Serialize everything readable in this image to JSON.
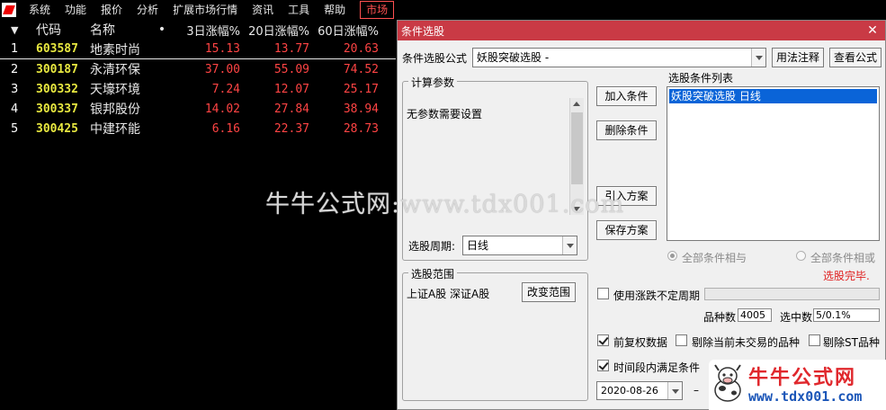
{
  "menu": {
    "items": [
      "系统",
      "功能",
      "报价",
      "分析",
      "扩展市场行情",
      "资讯",
      "工具",
      "帮助"
    ],
    "market": "市场"
  },
  "table": {
    "headers": {
      "code": "代码",
      "name": "名称",
      "dot": "•",
      "c3": "3日涨幅%",
      "c20": "20日涨幅%",
      "c60": "60日涨幅%"
    },
    "rows": [
      {
        "idx": "1",
        "code": "603587",
        "name": "地素时尚",
        "c3": "15.13",
        "c20": "13.77",
        "c60": "20.63"
      },
      {
        "idx": "2",
        "code": "300187",
        "name": "永清环保",
        "c3": "37.00",
        "c20": "55.09",
        "c60": "74.52"
      },
      {
        "idx": "3",
        "code": "300332",
        "name": "天壕环境",
        "c3": "7.24",
        "c20": "12.07",
        "c60": "25.17"
      },
      {
        "idx": "4",
        "code": "300337",
        "name": "银邦股份",
        "c3": "14.02",
        "c20": "27.84",
        "c60": "38.94"
      },
      {
        "idx": "5",
        "code": "300425",
        "name": "中建环能",
        "c3": "6.16",
        "c20": "22.37",
        "c60": "28.73"
      }
    ]
  },
  "dialog": {
    "title": "条件选股",
    "close": "✕",
    "formula_label": "条件选股公式",
    "formula_value": "妖股突破选股 -",
    "btn_usage": "用法注释",
    "btn_view": "查看公式",
    "params_group": "计算参数",
    "params_text": "无参数需要设置",
    "period_label": "选股周期:",
    "period_value": "日线",
    "btn_add": "加入条件",
    "btn_delete": "删除条件",
    "btn_import": "引入方案",
    "btn_save": "保存方案",
    "cond_list_label": "选股条件列表",
    "cond_list_items": [
      "妖股突破选股  日线"
    ],
    "radio_and": "全部条件相与",
    "radio_or": "全部条件相或",
    "status": "选股完毕.",
    "range_group": "选股范围",
    "range_text": "上证A股  深证A股",
    "btn_change_range": "改变范围",
    "chk_uncertain": "使用涨跌不定周期",
    "count_label": "品种数",
    "count_value": "4005",
    "selected_label": "选中数",
    "selected_value": "5/0.1%",
    "chk_prerights": "前复权数据",
    "chk_exclude_untraded": "剔除当前未交易的品种",
    "chk_exclude_st": "剔除ST品种",
    "chk_period_satisfy": "时间段内满足条件",
    "date_value": "2020-08-26",
    "dash": "–"
  },
  "watermark": {
    "center": "牛牛公式网:www.tdx001.com",
    "logo_title": "牛牛公式网",
    "logo_url": "www.tdx001.com"
  }
}
